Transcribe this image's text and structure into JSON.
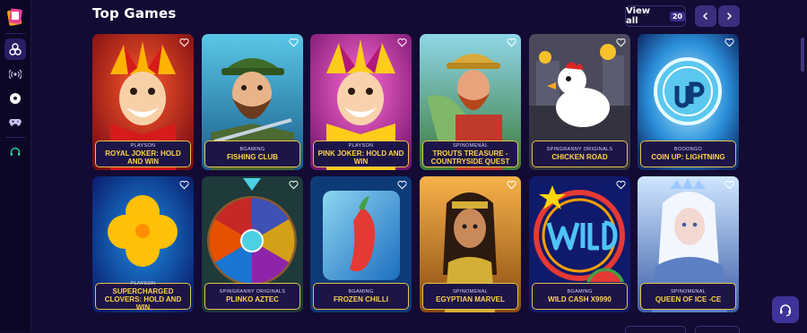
{
  "section": {
    "title": "Top Games"
  },
  "header": {
    "view_all_label": "View all",
    "view_all_count": "20",
    "prev_icon": "chevron-left-icon",
    "next_icon": "chevron-right-icon"
  },
  "sidebar": {
    "items": [
      {
        "icon": "logo-icon"
      },
      {
        "icon": "poker-chips-icon",
        "active": true
      },
      {
        "icon": "live-broadcast-icon"
      },
      {
        "icon": "soccer-ball-icon"
      },
      {
        "icon": "gamepad-icon"
      },
      {
        "icon": "headset-icon"
      }
    ]
  },
  "games": [
    {
      "provider": "PLAYSON",
      "name": "ROYAL JOKER: HOLD AND WIN"
    },
    {
      "provider": "BGAMING",
      "name": "FISHING CLUB"
    },
    {
      "provider": "PLAYSON",
      "name": "PINK JOKER: HOLD AND WIN"
    },
    {
      "provider": "SPINOMENAL",
      "name": "TROUTS TREASURE - COUNTRYSIDE QUEST"
    },
    {
      "provider": "SPINGRANNY ORIGINALS",
      "name": "CHICKEN ROAD"
    },
    {
      "provider": "BOOONGO",
      "name": "COIN UP: LIGHTNING"
    },
    {
      "provider": "PLAYSON",
      "name": "SUPERCHARGED CLOVERS: HOLD AND WIN"
    },
    {
      "provider": "SPINGRANNY ORIGINALS",
      "name": "PLINKO AZTEC"
    },
    {
      "provider": "BGAMING",
      "name": "FROZEN CHILLI"
    },
    {
      "provider": "SPINOMENAL",
      "name": "EGYPTIAN MARVEL"
    },
    {
      "provider": "BGAMING",
      "name": "WILD CASH X9990"
    },
    {
      "provider": "SPINOMENAL",
      "name": "QUEEN OF ICE -CE"
    }
  ],
  "colors": {
    "background": "#130b33",
    "label_border": "#e7c24a",
    "game_name": "#ffd34a",
    "nav_button": "#3a2e7e",
    "chat_button": "#3f339a"
  },
  "floating": {
    "chat_icon": "headset-icon"
  }
}
